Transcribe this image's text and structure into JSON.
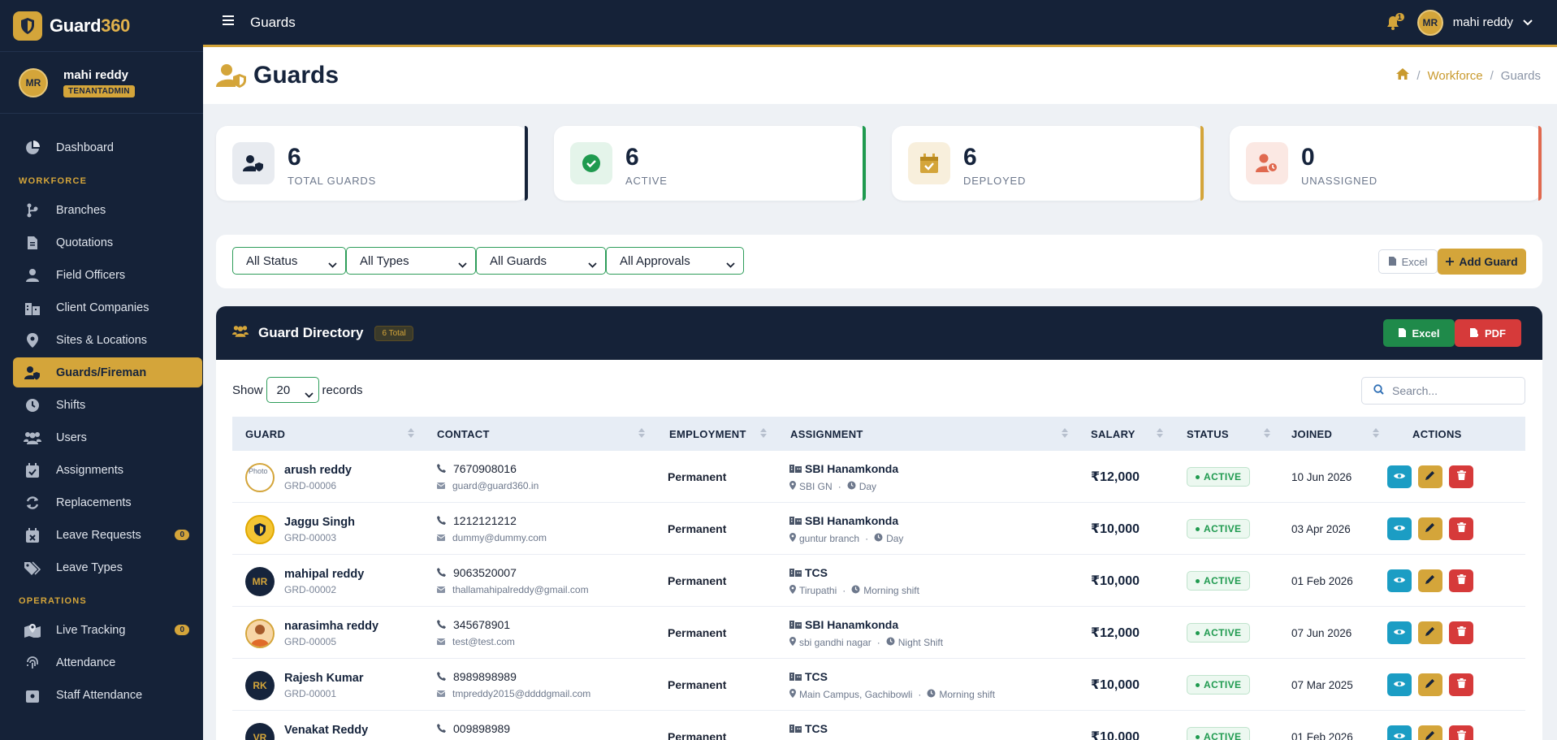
{
  "app": {
    "brand_prefix": "Guard",
    "brand_suffix": "360"
  },
  "profile": {
    "initials": "MR",
    "name": "mahi reddy",
    "role": "TENANTADMIN"
  },
  "nav": {
    "items_top": [
      {
        "label": "Dashboard",
        "icon": "chart-pie-icon"
      }
    ],
    "section_workforce": "WORKFORCE",
    "workforce": [
      {
        "label": "Branches",
        "icon": "branch-icon"
      },
      {
        "label": "Quotations",
        "icon": "document-icon"
      },
      {
        "label": "Field Officers",
        "icon": "user-icon"
      },
      {
        "label": "Client Companies",
        "icon": "building-icon"
      },
      {
        "label": "Sites & Locations",
        "icon": "map-pin-icon"
      },
      {
        "label": "Guards/Fireman",
        "icon": "user-shield-icon",
        "active": true
      },
      {
        "label": "Shifts",
        "icon": "clock-icon"
      },
      {
        "label": "Users",
        "icon": "users-icon"
      },
      {
        "label": "Assignments",
        "icon": "calendar-check-icon"
      },
      {
        "label": "Replacements",
        "icon": "refresh-icon"
      },
      {
        "label": "Leave Requests",
        "icon": "calendar-x-icon",
        "badge": "0"
      },
      {
        "label": "Leave Types",
        "icon": "tags-icon"
      }
    ],
    "section_operations": "OPERATIONS",
    "operations": [
      {
        "label": "Live Tracking",
        "icon": "map-location-icon",
        "badge": "0"
      },
      {
        "label": "Attendance",
        "icon": "fingerprint-icon"
      },
      {
        "label": "Staff Attendance",
        "icon": "calendar-user-icon"
      }
    ]
  },
  "topbar": {
    "title": "Guards",
    "notification_count": "1",
    "user_initials": "MR",
    "user_name": "mahi reddy"
  },
  "page": {
    "title": "Guards",
    "breadcrumb": [
      "Workforce",
      "Guards"
    ]
  },
  "stats": [
    {
      "value": "6",
      "label": "TOTAL GUARDS",
      "color": "#152238"
    },
    {
      "value": "6",
      "label": "ACTIVE",
      "color": "#1f9a4f"
    },
    {
      "value": "6",
      "label": "DEPLOYED",
      "color": "#d4a53a"
    },
    {
      "value": "0",
      "label": "UNASSIGNED",
      "color": "#e0694f"
    }
  ],
  "filters": {
    "status": "All Status",
    "types": "All Types",
    "guards": "All Guards",
    "approvals": "All Approvals",
    "excel_label": "Excel",
    "add_label": "Add Guard"
  },
  "directory": {
    "title": "Guard Directory",
    "count": "6 Total",
    "excel_label": "Excel",
    "pdf_label": "PDF",
    "show_label": "Show",
    "records_label": "records",
    "page_size": "20",
    "search_placeholder": "Search...",
    "columns": [
      "GUARD",
      "CONTACT",
      "EMPLOYMENT",
      "ASSIGNMENT",
      "SALARY",
      "STATUS",
      "JOINED",
      "ACTIONS"
    ],
    "rows": [
      {
        "name": "arush reddy",
        "code": "GRD-00006",
        "avatar": "photo",
        "avatar_alt": "Photo",
        "phone": "7670908016",
        "email": "guard@guard360.in",
        "employment": "Permanent",
        "site": "SBI Hanamkonda",
        "location": "SBI GN",
        "shift": "Day",
        "salary": "₹12,000",
        "status": "ACTIVE",
        "joined": "10 Jun 2026"
      },
      {
        "name": "Jaggu Singh",
        "code": "GRD-00003",
        "avatar": "shield",
        "phone": "1212121212",
        "email": "dummy@dummy.com",
        "employment": "Permanent",
        "site": "SBI Hanamkonda",
        "location": "guntur branch",
        "shift": "Day",
        "salary": "₹10,000",
        "status": "ACTIVE",
        "joined": "03 Apr 2026"
      },
      {
        "name": "mahipal reddy",
        "code": "GRD-00002",
        "avatar": "initials",
        "initials": "MR",
        "phone": "9063520007",
        "email": "thallamahipalreddy@gmail.com",
        "employment": "Permanent",
        "site": "TCS",
        "location": "Tirupathi",
        "shift": "Morning shift",
        "salary": "₹10,000",
        "status": "ACTIVE",
        "joined": "01 Feb 2026"
      },
      {
        "name": "narasimha reddy",
        "code": "GRD-00005",
        "avatar": "photo2",
        "phone": "345678901",
        "email": "test@test.com",
        "employment": "Permanent",
        "site": "SBI Hanamkonda",
        "location": "sbi gandhi nagar",
        "shift": "Night Shift",
        "salary": "₹12,000",
        "status": "ACTIVE",
        "joined": "07 Jun 2026"
      },
      {
        "name": "Rajesh Kumar",
        "code": "GRD-00001",
        "avatar": "initials",
        "initials": "RK",
        "phone": "8989898989",
        "email": "tmpreddy2015@ddddgmail.com",
        "employment": "Permanent",
        "site": "TCS",
        "location": "Main Campus, Gachibowli",
        "shift": "Morning shift",
        "salary": "₹10,000",
        "status": "ACTIVE",
        "joined": "07 Mar 2025"
      },
      {
        "name": "Venakat Reddy",
        "code": "",
        "avatar": "initials",
        "initials": "VR",
        "phone": "009898989",
        "email": "",
        "employment": "Permanent",
        "site": "TCS",
        "location": "",
        "shift": "",
        "salary": "₹10,000",
        "status": "ACTIVE",
        "joined": "01 Feb 2026"
      }
    ]
  },
  "colors": {
    "navy": "#152238",
    "gold": "#d4a53a",
    "green": "#1f9a4f",
    "red": "#d63a3a",
    "cyan": "#1b9dc4"
  }
}
